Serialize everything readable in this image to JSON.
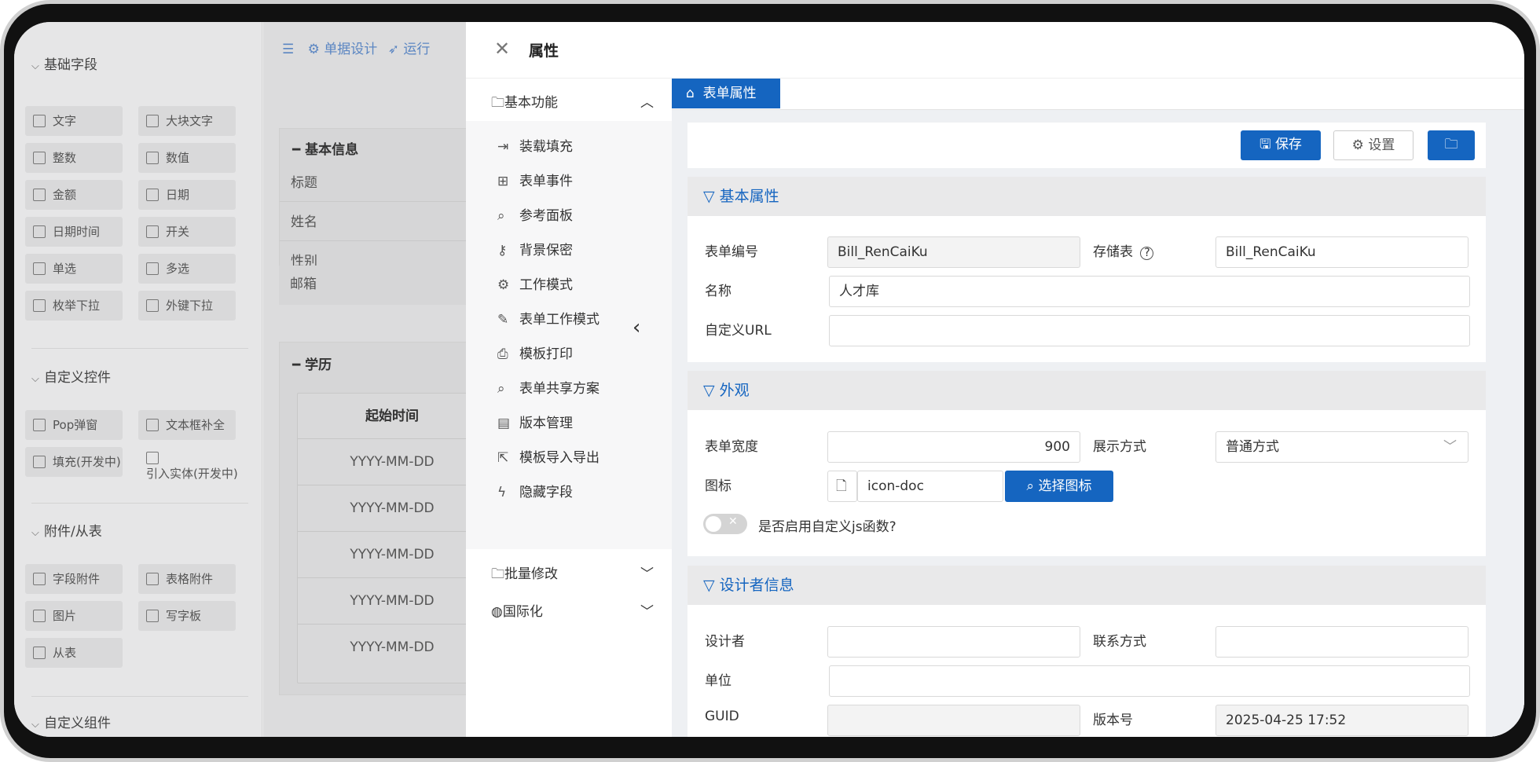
{
  "left_panel": {
    "section1": "基础字段",
    "basic_fields": [
      "文字",
      "大块文字",
      "整数",
      "数值",
      "金额",
      "日期",
      "日期时间",
      "开关",
      "单选",
      "多选",
      "枚举下拉",
      "外键下拉"
    ],
    "section2": "自定义控件",
    "custom_controls": [
      "Pop弹窗",
      "文本框补全",
      "填充(开发中)",
      "引入实体(开发中)"
    ],
    "section3": "附件/从表",
    "attachments": [
      "字段附件",
      "表格附件",
      "图片",
      "写字板",
      "从表"
    ],
    "section4": "自定义组件"
  },
  "designer": {
    "toolbar": [
      "单据设计",
      "运行"
    ],
    "group1": "基本信息",
    "fields": [
      "标题",
      "姓名",
      "性别",
      "邮箱"
    ],
    "group2": "学历",
    "table_header": "起始时间",
    "table_cells": [
      "YYYY-MM-DD",
      "YYYY-MM-DD",
      "YYYY-MM-DD",
      "YYYY-MM-DD",
      "YYYY-MM-DD"
    ]
  },
  "dialog": {
    "title": "属性",
    "nav": {
      "basic": "基本功能",
      "items": [
        "装载填充",
        "表单事件",
        "参考面板",
        "背景保密",
        "工作模式",
        "表单工作模式",
        "模板打印",
        "表单共享方案",
        "版本管理",
        "模板导入导出",
        "隐藏字段"
      ],
      "batch": "批量修改",
      "i18n": "国际化"
    },
    "tab": "表单属性",
    "buttons": {
      "save": "保存",
      "settings": "设置"
    },
    "basic_props": {
      "title": "基本属性",
      "form_no_label": "表单编号",
      "form_no": "Bill_RenCaiKu",
      "storage_label": "存储表",
      "storage": "Bill_RenCaiKu",
      "name_label": "名称",
      "name": "人才库",
      "url_label": "自定义URL",
      "url": ""
    },
    "appearance": {
      "title": "外观",
      "width_label": "表单宽度",
      "width": "900",
      "display_label": "展示方式",
      "display": "普通方式",
      "icon_label": "图标",
      "icon": "icon-doc",
      "choose_icon": "选择图标",
      "js_toggle": "是否启用自定义js函数?",
      "js_enabled": false
    },
    "designer_info": {
      "title": "设计者信息",
      "designer_label": "设计者",
      "designer": "",
      "contact_label": "联系方式",
      "contact": "",
      "org_label": "单位",
      "org": "",
      "guid_label": "GUID",
      "guid": "",
      "version_label": "版本号",
      "version": "2025-04-25 17:52"
    }
  }
}
